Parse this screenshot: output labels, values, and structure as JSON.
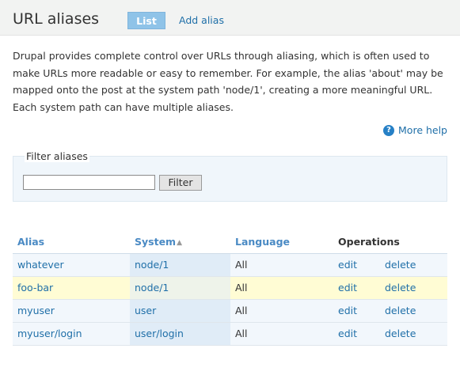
{
  "header": {
    "title": "URL aliases",
    "tabs": [
      {
        "label": "List",
        "active": true
      },
      {
        "label": "Add alias",
        "active": false
      }
    ]
  },
  "intro_text": "Drupal provides complete control over URLs through aliasing, which is often used to make URLs more readable or easy to remember. For example, the alias 'about' may be mapped onto the post at the system path 'node/1', creating a more meaningful URL. Each system path can have multiple aliases.",
  "more_help": {
    "label": "More help",
    "icon": "help-icon"
  },
  "filter": {
    "legend": "Filter aliases",
    "input_value": "",
    "button_label": "Filter"
  },
  "table": {
    "headers": {
      "alias": "Alias",
      "system": "System",
      "language": "Language",
      "operations": "Operations"
    },
    "sort_icon": "sort-ascending-icon",
    "rows": [
      {
        "alias": "whatever",
        "system": "node/1",
        "language": "All",
        "edit": "edit",
        "delete": "delete",
        "highlight": false
      },
      {
        "alias": "foo-bar",
        "system": "node/1",
        "language": "All",
        "edit": "edit",
        "delete": "delete",
        "highlight": true
      },
      {
        "alias": "myuser",
        "system": "user",
        "language": "All",
        "edit": "edit",
        "delete": "delete",
        "highlight": false
      },
      {
        "alias": "myuser/login",
        "system": "user/login",
        "language": "All",
        "edit": "edit",
        "delete": "delete",
        "highlight": false
      }
    ]
  },
  "colors": {
    "link": "#1f6fa8",
    "header_bg": "#f2f3f2",
    "active_tab_bg": "#8fc3e8",
    "row_bg": "#f2f7fc",
    "highlight_row_bg": "#fffcd4"
  }
}
